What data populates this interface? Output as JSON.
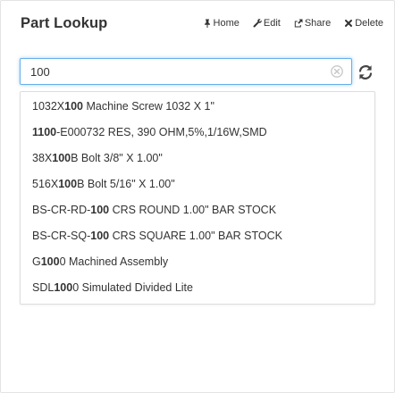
{
  "header": {
    "title": "Part Lookup",
    "actions": [
      {
        "label": "Home",
        "icon": "pin-icon"
      },
      {
        "label": "Edit",
        "icon": "wrench-icon"
      },
      {
        "label": "Share",
        "icon": "share-icon"
      },
      {
        "label": "Delete",
        "icon": "close-icon"
      }
    ]
  },
  "search": {
    "value": "100",
    "accent_color": "#66afe9"
  },
  "results": [
    {
      "pre": "1032X",
      "match": "100",
      "post": " Machine Screw 1032 X 1\""
    },
    {
      "pre": "",
      "match": "1100",
      "post": "-E000732 RES, 390 OHM,5%,1/16W,SMD"
    },
    {
      "pre": "38X",
      "match": "100",
      "post": "B Bolt 3/8\" X 1.00\""
    },
    {
      "pre": "516X",
      "match": "100",
      "post": "B Bolt 5/16\" X 1.00\""
    },
    {
      "pre": "BS-CR-RD-",
      "match": "100",
      "post": " CRS ROUND 1.00\" BAR STOCK"
    },
    {
      "pre": "BS-CR-SQ-",
      "match": "100",
      "post": " CRS SQUARE 1.00\" BAR STOCK"
    },
    {
      "pre": "G",
      "match": "100",
      "post": "0 Machined Assembly"
    },
    {
      "pre": "SDL",
      "match": "100",
      "post": "0 Simulated Divided Lite"
    }
  ]
}
